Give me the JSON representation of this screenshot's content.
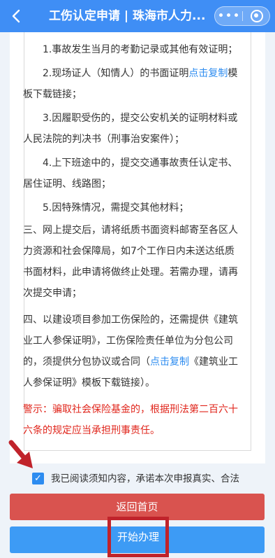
{
  "header": {
    "back_icon": "chevron-left-icon",
    "title": "工伤认定申请 | 珠海市人力...",
    "more_icon": "more-dots-icon",
    "more_glyph": "•••",
    "close_icon": "target-circle-icon"
  },
  "notice": {
    "items": [
      "1.事故发生当月的考勤记录或其他有效证明；",
      "2.现场证人（知情人）的书面证明",
      "3.因履职受伤的，提交公安机关的证明材料或人民法院的判决书（刑事治安案件）；",
      "4.上下班途中的，提交交通事故责任认定书、居住证明、线路图；",
      "5.因特殊情况，需提交其他材料；",
      "三、网上提交后，请将纸质书面资料邮寄至各区人力资源和社会保障局，如7个工作日内未送达纸质书面材料，此申请将做终止处理。若需办理，请再次提交申请；",
      "四、以建设项目参加工伤保险的，还需提供《建筑业工人参保证明》，工伤保险责任单位为分包公司的，须提供分包协议或合同（",
      "《建筑业工人参保证明》模板下载链接）。"
    ],
    "item2_link": "点击复制",
    "item2_suffix": "模板下载链接；",
    "item4_link": "点击复制",
    "warning": "警示：骗取社会保险基金的，根据刑法第二百六十六条的规定应当承担刑事责任。"
  },
  "agreement": {
    "checked": true,
    "check_glyph": "✓",
    "label": "我已阅读须知内容，承诺本次申报真实、合法"
  },
  "buttons": {
    "home": "返回首页",
    "start": "开始办理"
  },
  "colors": {
    "header": "#3f8ef5",
    "link": "#2d8cf0",
    "warning": "#e0251b",
    "home_button": "#d9534f",
    "start_button": "#3d9bf5",
    "annotation": "#c0232b"
  }
}
